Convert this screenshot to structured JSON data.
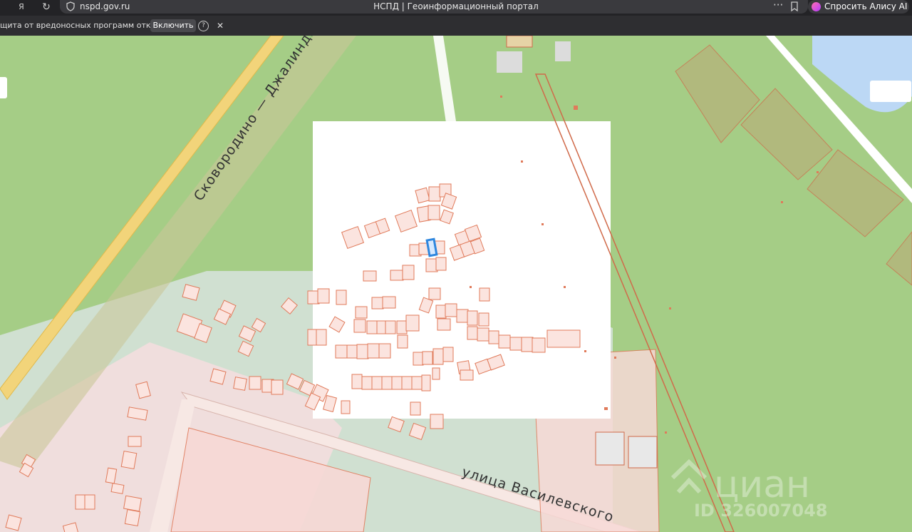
{
  "browser": {
    "url_host": "nspd.gov.ru",
    "page_title": "НСПД | Геоинформационный портал",
    "alice_button": "Спросить Алису AI"
  },
  "infobar": {
    "message": "щита от вредоносных программ отключена",
    "enable_button": "Включить",
    "help": "?",
    "close": "✕"
  },
  "map": {
    "road_label_1": "Сковородино — Джалинда",
    "street_label_1": "улица Василевского",
    "watermark_brand": "циан",
    "watermark_id": "ID 326007048",
    "colors": {
      "land": "#a5cd86",
      "road": "#f2d47a",
      "parcel_fill": "#f7d9d6",
      "parcel_stroke": "#e07a5a",
      "selected": "#2e86de",
      "water": "#bcd8f5"
    }
  }
}
